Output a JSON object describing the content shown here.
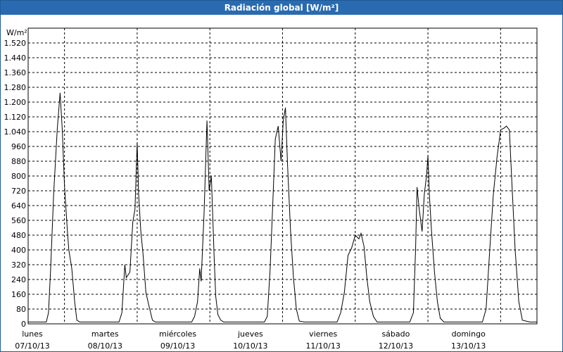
{
  "window": {
    "title": "Radiación global [W/m²]"
  },
  "colors": {
    "title_bar": "#2a6ab0",
    "title_text": "#ffffff",
    "line": "#000000",
    "grid": "#000000",
    "background": "#ffffff"
  },
  "chart_data": {
    "type": "line",
    "title": "Radiación global [W/m²]",
    "ylabel": "W/m²",
    "xlabel": "",
    "ylim": [
      0,
      1600
    ],
    "yticks": [
      "0",
      "80",
      "160",
      "240",
      "320",
      "400",
      "480",
      "560",
      "640",
      "720",
      "800",
      "880",
      "960",
      "1.040",
      "1.120",
      "1.200",
      "1.280",
      "1.360",
      "1.440",
      "1.520"
    ],
    "ytick_values": [
      0,
      80,
      160,
      240,
      320,
      400,
      480,
      560,
      640,
      720,
      800,
      880,
      960,
      1040,
      1120,
      1200,
      1280,
      1360,
      1440,
      1520
    ],
    "x_unit": "days",
    "xlim": [
      0,
      7.0
    ],
    "days": [
      {
        "name": "lunes",
        "date": "07/10/13"
      },
      {
        "name": "martes",
        "date": "08/10/13"
      },
      {
        "name": "miércoles",
        "date": "09/10/13"
      },
      {
        "name": "jueves",
        "date": "10/10/13"
      },
      {
        "name": "viernes",
        "date": "11/10/13"
      },
      {
        "name": "sábado",
        "date": "12/10/13"
      },
      {
        "name": "domingo",
        "date": "13/10/13"
      }
    ],
    "grid": true,
    "series": [
      {
        "x": [
          0.0,
          0.25,
          0.28,
          0.31,
          0.35,
          0.4,
          0.44,
          0.47,
          0.5,
          0.54,
          0.56,
          0.6,
          0.64,
          0.67,
          0.71,
          0.76,
          0.85,
          1.0,
          1.25,
          1.29,
          1.33,
          1.35,
          1.4,
          1.44,
          1.47,
          1.5,
          1.52,
          1.55,
          1.58,
          1.62,
          1.66,
          1.71,
          1.75,
          1.85,
          2.0,
          2.25,
          2.29,
          2.33,
          2.36,
          2.38,
          2.42,
          2.46,
          2.49,
          2.52,
          2.56,
          2.58,
          2.61,
          2.65,
          2.69,
          2.73,
          2.8,
          2.9,
          3.0,
          3.25,
          3.29,
          3.33,
          3.37,
          3.4,
          3.44,
          3.48,
          3.51,
          3.54,
          3.57,
          3.61,
          3.65,
          3.69,
          3.73,
          3.8,
          3.9,
          4.0,
          4.25,
          4.3,
          4.35,
          4.4,
          4.45,
          4.5,
          4.55,
          4.58,
          4.62,
          4.66,
          4.7,
          4.75,
          4.8,
          4.9,
          5.0,
          5.25,
          5.3,
          5.33,
          5.35,
          5.38,
          5.42,
          5.45,
          5.48,
          5.5,
          5.52,
          5.55,
          5.59,
          5.63,
          5.67,
          5.72,
          5.8,
          5.9,
          6.0,
          6.25,
          6.3,
          6.35,
          6.4,
          6.45,
          6.5,
          6.55,
          6.58,
          6.62,
          6.65,
          6.7,
          6.75,
          6.8,
          6.9,
          7.0
        ],
        "y": [
          10,
          10,
          60,
          300,
          700,
          1050,
          1250,
          1050,
          750,
          500,
          400,
          300,
          120,
          20,
          10,
          10,
          10,
          10,
          10,
          60,
          320,
          250,
          280,
          550,
          620,
          980,
          700,
          500,
          380,
          170,
          100,
          20,
          10,
          10,
          10,
          10,
          40,
          120,
          300,
          230,
          600,
          1100,
          720,
          800,
          350,
          150,
          50,
          20,
          10,
          10,
          10,
          10,
          10,
          10,
          40,
          300,
          700,
          1000,
          1070,
          880,
          1100,
          1170,
          850,
          500,
          250,
          80,
          15,
          10,
          10,
          10,
          10,
          60,
          170,
          370,
          410,
          480,
          460,
          490,
          420,
          250,
          120,
          40,
          10,
          10,
          10,
          10,
          60,
          400,
          740,
          620,
          500,
          700,
          800,
          910,
          700,
          500,
          280,
          120,
          30,
          10,
          10,
          10,
          10,
          10,
          80,
          400,
          700,
          900,
          1050,
          1060,
          1070,
          1050,
          800,
          400,
          120,
          20,
          10,
          10
        ]
      }
    ]
  }
}
